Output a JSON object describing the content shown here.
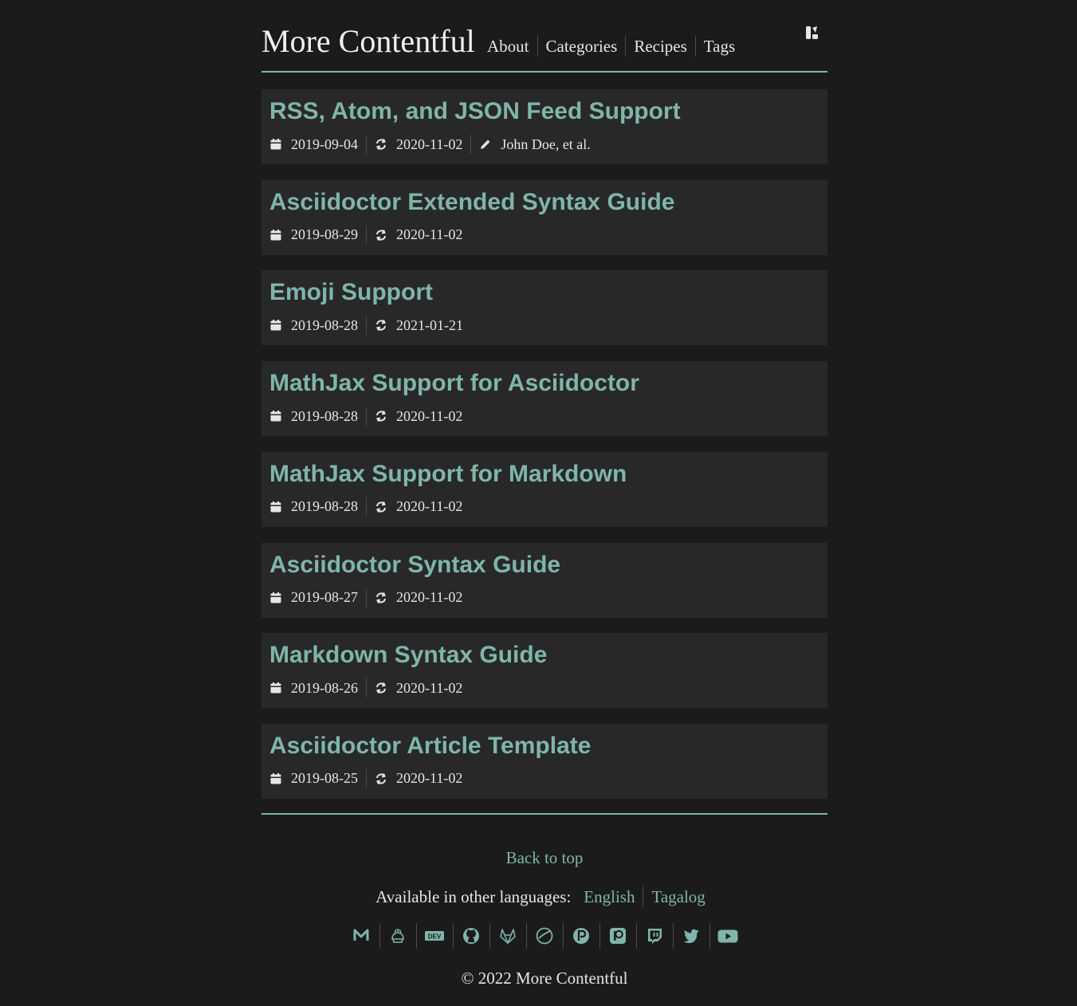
{
  "header": {
    "site_title": "More Contentful",
    "nav": [
      "About",
      "Categories",
      "Recipes",
      "Tags"
    ]
  },
  "posts": [
    {
      "title": "RSS, Atom, and JSON Feed Support",
      "published": "2019-09-04",
      "updated": "2020-11-02",
      "author": "John Doe, et al."
    },
    {
      "title": "Asciidoctor Extended Syntax Guide",
      "published": "2019-08-29",
      "updated": "2020-11-02"
    },
    {
      "title": "Emoji Support",
      "published": "2019-08-28",
      "updated": "2021-01-21"
    },
    {
      "title": "MathJax Support for Asciidoctor",
      "published": "2019-08-28",
      "updated": "2020-11-02"
    },
    {
      "title": "MathJax Support for Markdown",
      "published": "2019-08-28",
      "updated": "2020-11-02"
    },
    {
      "title": "Asciidoctor Syntax Guide",
      "published": "2019-08-27",
      "updated": "2020-11-02"
    },
    {
      "title": "Markdown Syntax Guide",
      "published": "2019-08-26",
      "updated": "2020-11-02"
    },
    {
      "title": "Asciidoctor Article Template",
      "published": "2019-08-25",
      "updated": "2020-11-02"
    }
  ],
  "footer": {
    "back_to_top": "Back to top",
    "languages_label": "Available in other languages:",
    "languages": [
      "English",
      "Tagalog"
    ],
    "socials": [
      "mastodon-icon",
      "kofi-icon",
      "dev-icon",
      "github-icon",
      "gitlab-icon",
      "liberapay-icon",
      "paypal-icon",
      "patreon-icon",
      "twitch-icon",
      "twitter-icon",
      "youtube-icon"
    ],
    "copyright": "© 2022 More Contentful"
  },
  "colors": {
    "background": "#1b1b1b",
    "card": "#282828",
    "accent": "#7fb5aa",
    "text": "#e6e6e6"
  }
}
